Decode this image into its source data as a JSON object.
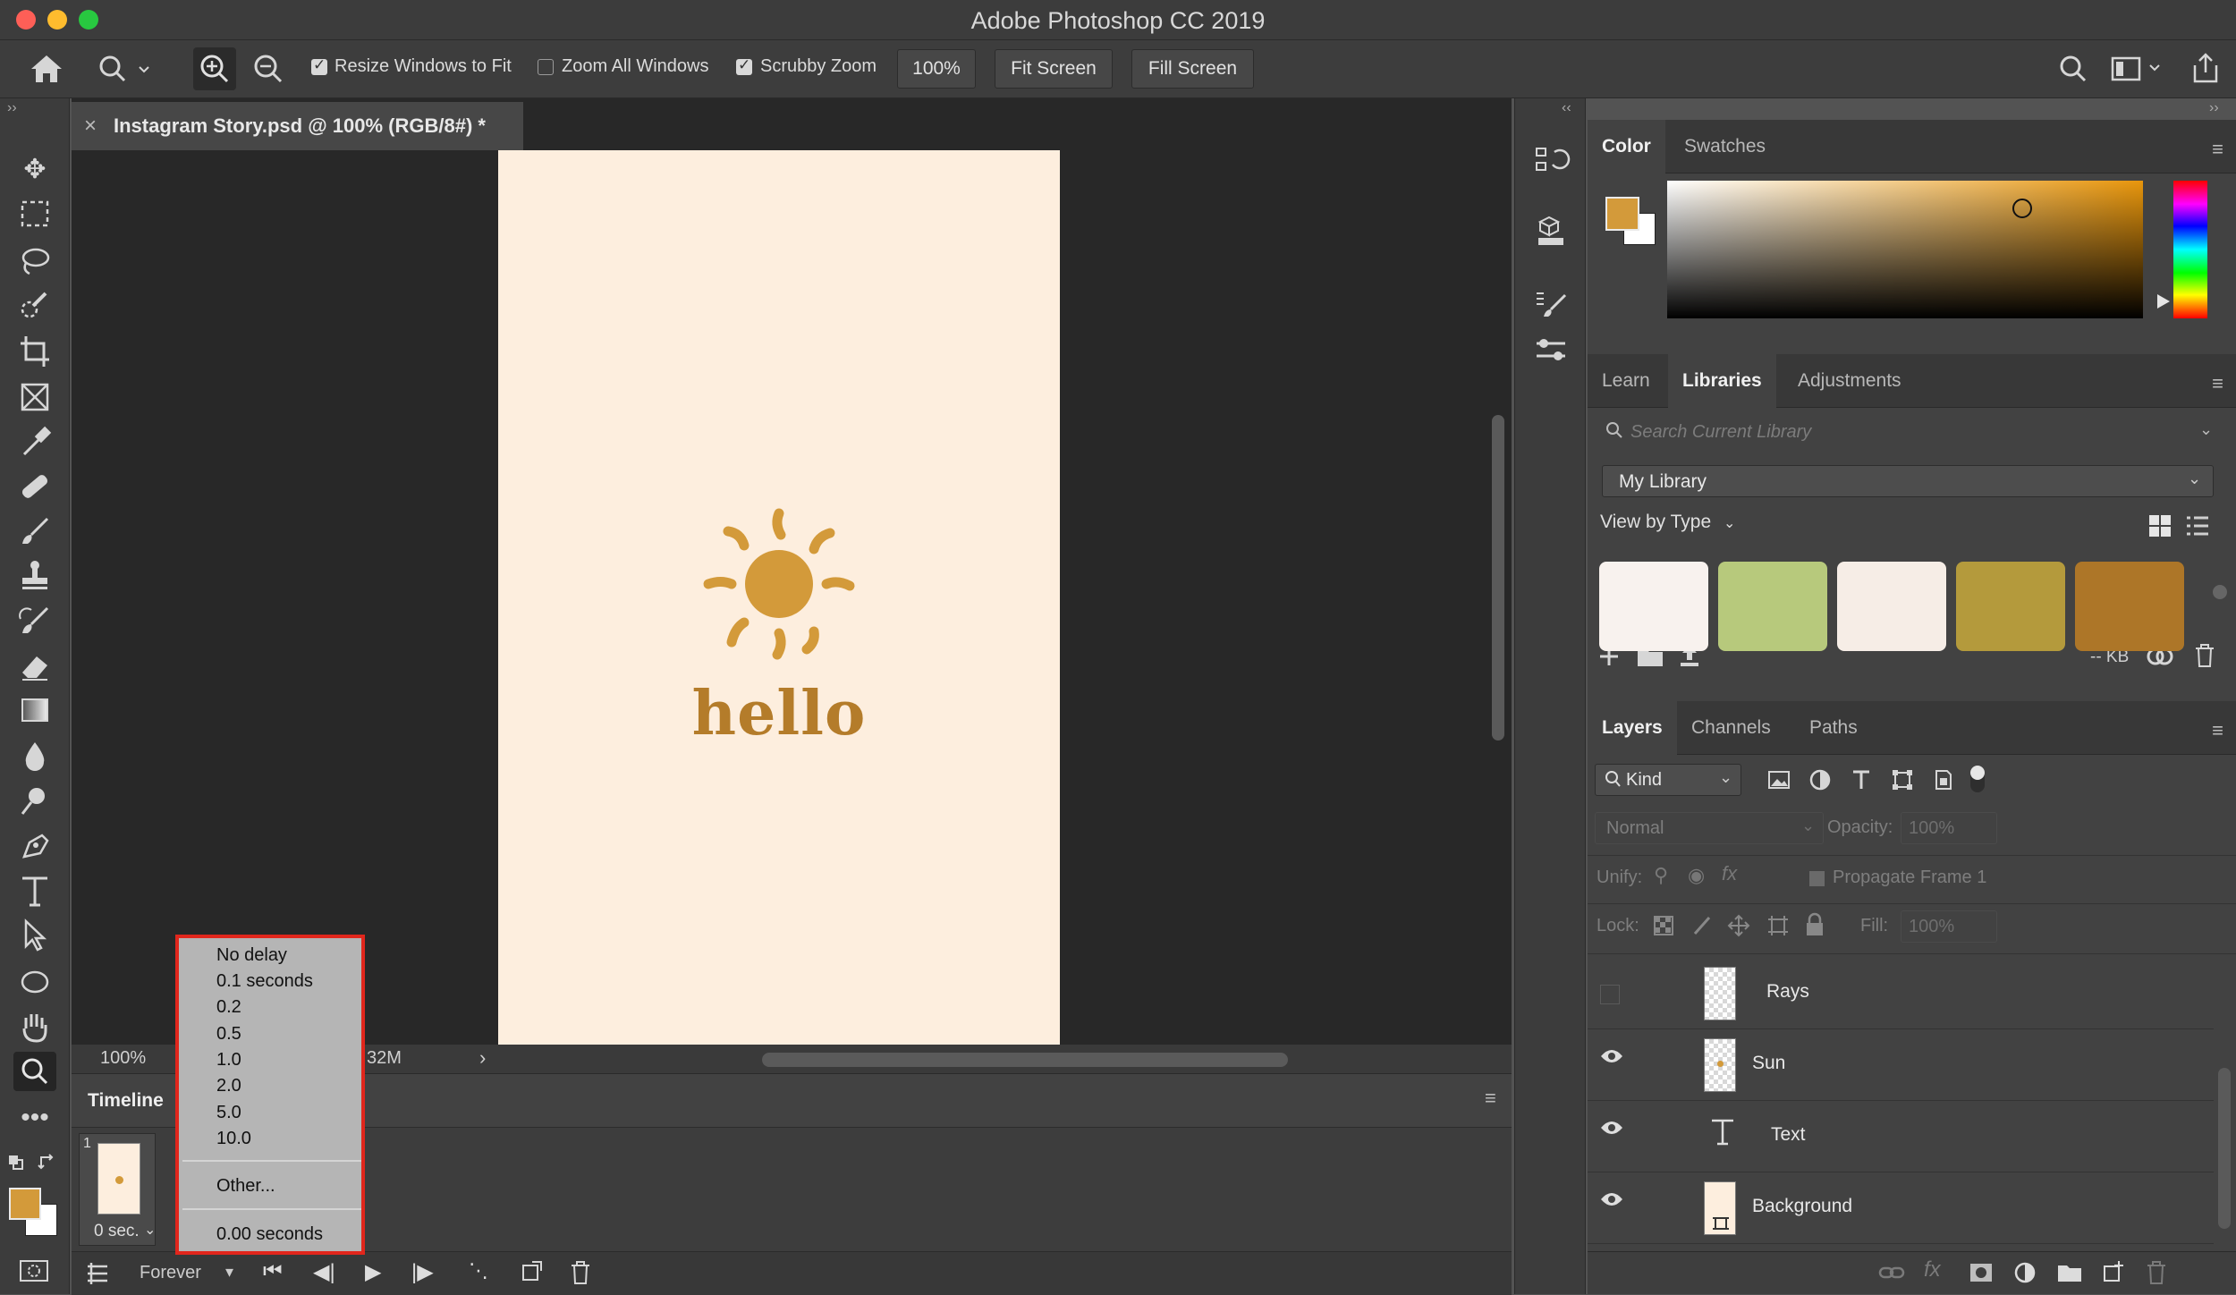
{
  "window": {
    "title": "Adobe Photoshop CC 2019"
  },
  "options_bar": {
    "resize_windows_label": "Resize Windows to Fit",
    "zoom_all_label": "Zoom All Windows",
    "scrubby_zoom_label": "Scrubby Zoom",
    "zoom_value": "100%",
    "fit_screen_label": "Fit Screen",
    "fill_screen_label": "Fill Screen"
  },
  "document": {
    "tab_title": "Instagram Story.psd @ 100% (RGB/8#) *",
    "canvas_text": "hello",
    "zoom_status": "100%",
    "doc_size_fragment": "32M"
  },
  "timeline": {
    "title": "Timeline",
    "frame_number": "1",
    "frame_delay": "0 sec.",
    "loop_option": "Forever"
  },
  "delay_menu": {
    "items": [
      "No delay",
      "0.1 seconds",
      "0.2",
      "0.5",
      "1.0",
      "2.0",
      "5.0",
      "10.0"
    ],
    "other_label": "Other...",
    "current_value": "0.00 seconds"
  },
  "color_panel": {
    "tabs": [
      "Color",
      "Swatches"
    ],
    "foreground_color": "#d39a3a",
    "background_color": "#ffffff"
  },
  "libraries_panel": {
    "tabs": [
      "Learn",
      "Libraries",
      "Adjustments"
    ],
    "search_placeholder": "Search Current Library",
    "library_name": "My Library",
    "view_by": "View by Type",
    "swatches": [
      "#f8f2ee",
      "#b7c97c",
      "#f6ede6",
      "#b49a3c",
      "#ad7628"
    ],
    "storage": "-- KB"
  },
  "layers_panel": {
    "tabs": [
      "Layers",
      "Channels",
      "Paths"
    ],
    "filter_kind": "Kind",
    "blend_mode": "Normal",
    "opacity_label": "Opacity:",
    "opacity_value": "100%",
    "unify_label": "Unify:",
    "propagate_label": "Propagate Frame 1",
    "lock_label": "Lock:",
    "fill_label": "Fill:",
    "fill_value": "100%",
    "layers": [
      {
        "name": "Rays",
        "visible": false
      },
      {
        "name": "Sun",
        "visible": true
      },
      {
        "name": "Text",
        "visible": true
      },
      {
        "name": "Background",
        "visible": true
      }
    ]
  }
}
